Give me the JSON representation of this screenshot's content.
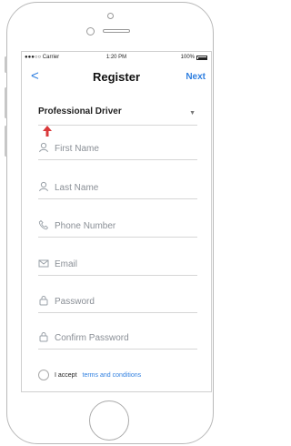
{
  "status_bar": {
    "carrier": "●●●○○ Carrier",
    "time": "1:20 PM",
    "battery": "100%"
  },
  "nav": {
    "back_symbol": "<",
    "title": "Register",
    "next_label": "Next"
  },
  "role_select": {
    "value": "Professional Driver"
  },
  "fields": {
    "first_name": "First Name",
    "last_name": "Last Name",
    "phone": "Phone Number",
    "email": "Email",
    "password": "Password",
    "confirm_password": "Confirm Password"
  },
  "terms": {
    "prefix": "I accept",
    "link": "terms and conditions"
  },
  "colors": {
    "accent": "#2f7fe0",
    "pointer_arrow": "#d9383a"
  }
}
